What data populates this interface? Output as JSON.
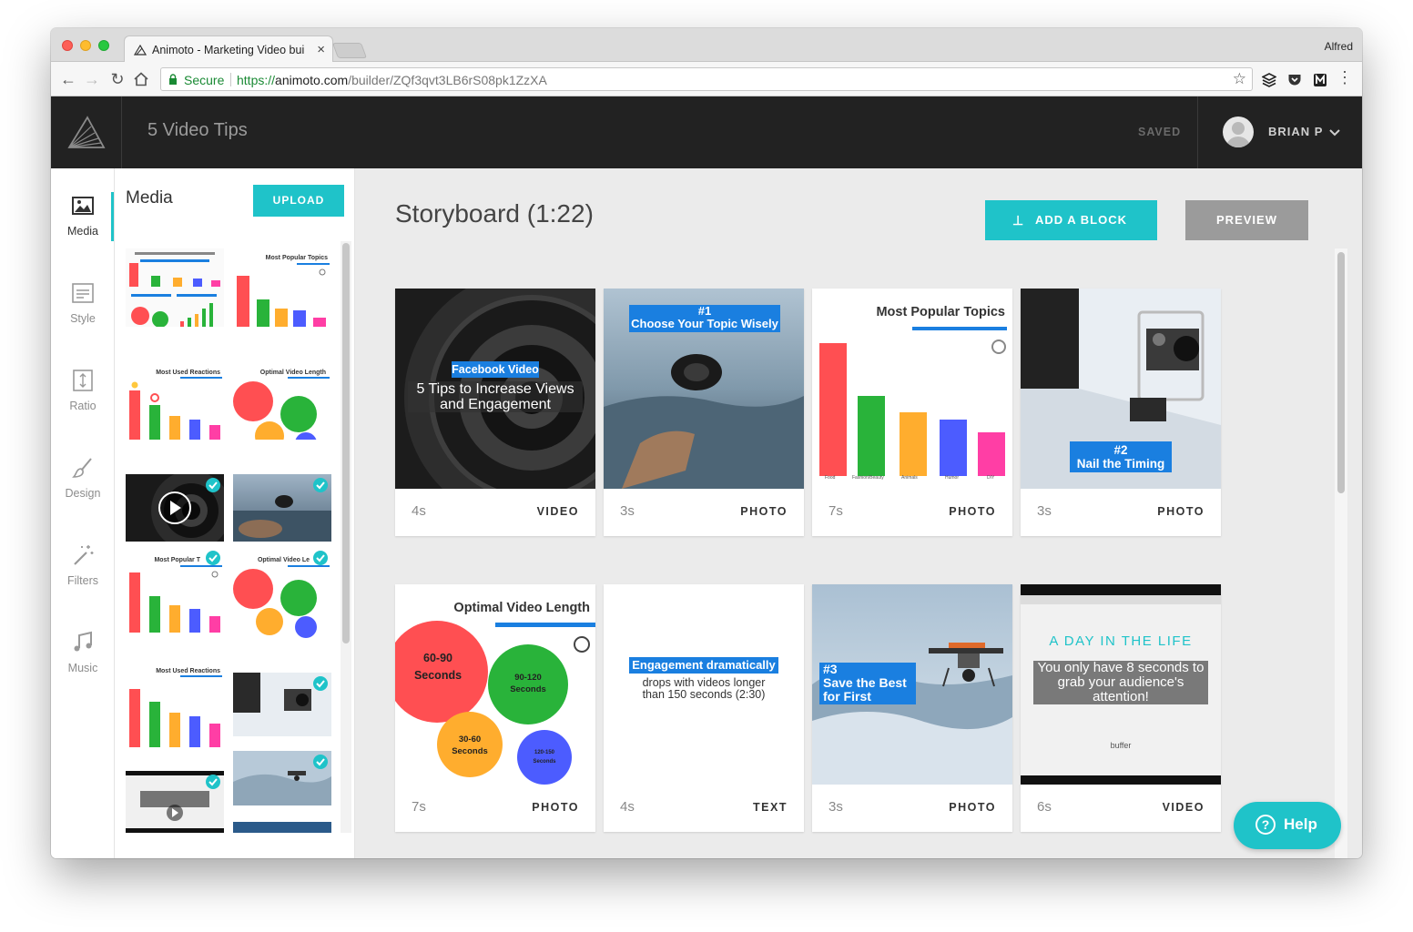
{
  "browser": {
    "tab_title": "Animoto - Marketing Video bui",
    "profile_name": "Alfred",
    "secure_label": "Secure",
    "url_scheme": "https://",
    "url_host": "animoto.com",
    "url_path": "/builder/ZQf3qvt3LB6rS08pk1ZzXA"
  },
  "header": {
    "project_title": "5 Video Tips",
    "save_status": "SAVED",
    "user_name": "BRIAN P"
  },
  "rail": {
    "items": [
      {
        "label": "Media",
        "icon": "image-icon"
      },
      {
        "label": "Style",
        "icon": "style-icon"
      },
      {
        "label": "Ratio",
        "icon": "ratio-icon"
      },
      {
        "label": "Design",
        "icon": "brush-icon"
      },
      {
        "label": "Filters",
        "icon": "magic-wand-icon"
      },
      {
        "label": "Music",
        "icon": "music-note-icon"
      }
    ]
  },
  "media": {
    "title": "Media",
    "upload_label": "UPLOAD",
    "thumb_texts": {
      "popular": "Most Popular Topics",
      "reactions": "Most Used Reactions",
      "length": "Optimal Video Length",
      "popular_short": "Most Popular T",
      "length_short": "Optimal Video Le",
      "b60": "60-90 Seconds",
      "b90": "90-120 Seconds",
      "b30": "30-60 Seconds",
      "b120": "120-150 Seconds"
    }
  },
  "storyboard": {
    "title": "Storyboard (1:22)",
    "add_block_label": "ADD A BLOCK",
    "preview_label": "PREVIEW",
    "cards": [
      {
        "duration": "4s",
        "kind": "VIDEO",
        "tag": "Facebook Video",
        "text": "5 Tips to Increase Views and Engagement"
      },
      {
        "duration": "3s",
        "kind": "PHOTO",
        "tag": "#1",
        "text": "Choose Your Topic Wisely"
      },
      {
        "duration": "7s",
        "kind": "PHOTO",
        "text": "Most Popular Topics",
        "bar_labels": [
          "Food",
          "Fashion/Beauty",
          "Animals",
          "Humor",
          "DIY"
        ]
      },
      {
        "duration": "3s",
        "kind": "PHOTO",
        "tag": "#2",
        "text": "Nail the Timing"
      },
      {
        "duration": "7s",
        "kind": "PHOTO",
        "text": "Optimal Video Length",
        "bubbles": [
          "60-90 Seconds",
          "90-120 Seconds",
          "30-60 Seconds",
          "120-150 Seconds"
        ]
      },
      {
        "duration": "4s",
        "kind": "TEXT",
        "tag": "Engagement dramatically",
        "text": "drops with videos longer than 150 seconds (2:30)"
      },
      {
        "duration": "3s",
        "kind": "PHOTO",
        "tag": "#3",
        "text": "Save the Best for First"
      },
      {
        "duration": "6s",
        "kind": "VIDEO",
        "tag": "A DAY IN THE LIFE",
        "text": "You only have 8 seconds to grab your audience's attention!",
        "brand": "buffer"
      }
    ]
  },
  "help": {
    "label": "Help"
  },
  "colors": {
    "accent": "#1fc3c9",
    "header": "#222222",
    "preview": "#9b9b9b",
    "chart_blue": "#1a7fe0"
  }
}
